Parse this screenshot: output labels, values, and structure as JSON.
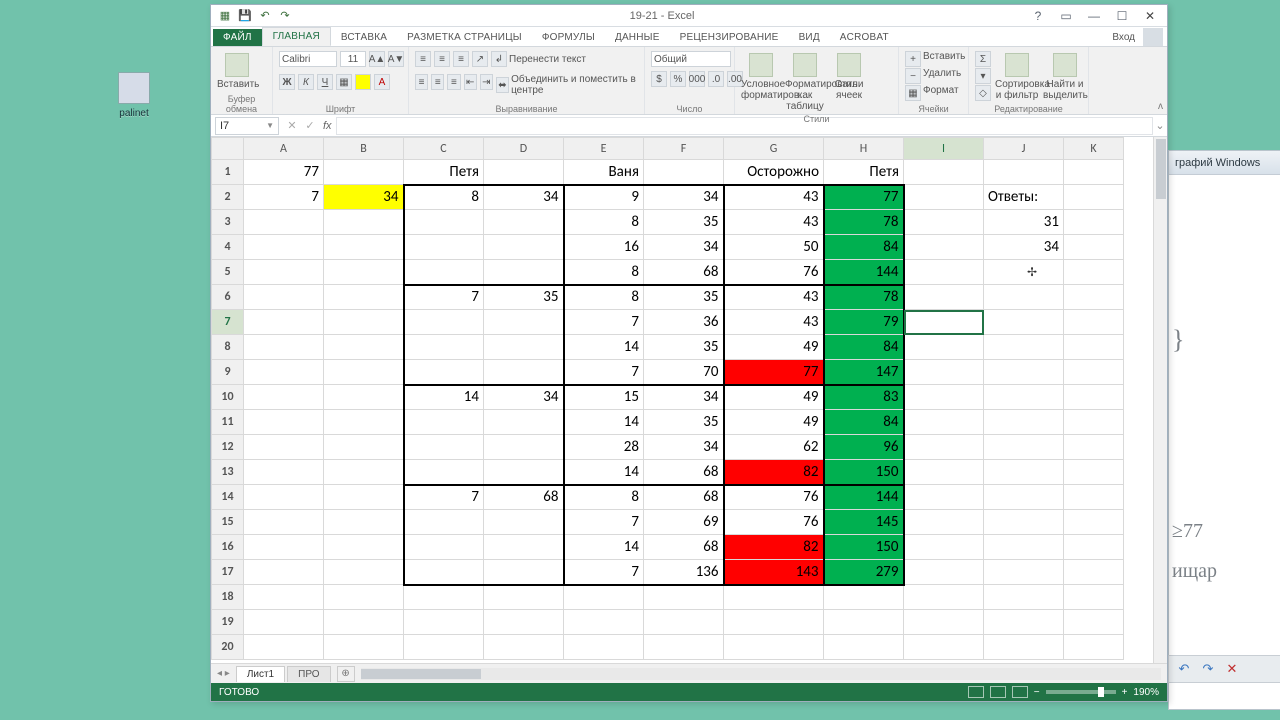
{
  "desktop_icon": {
    "label": "palinet"
  },
  "behind_window": {
    "title": "графий Windows"
  },
  "annotations": {
    "a1": "≥77",
    "a2": "ищар",
    "a3": "}"
  },
  "behind_toolbar": {
    "undo": "↶",
    "redo": "↷",
    "close": "✕"
  },
  "app": {
    "title": "19-21 - Excel",
    "qat": {
      "save": "💾",
      "undo": "↶",
      "redo": "↷"
    },
    "win": {
      "help": "?",
      "ribbon": "▭",
      "min": "—",
      "max": "☐",
      "close": "✕"
    },
    "tabs": {
      "file": "ФАЙЛ",
      "home": "ГЛАВНАЯ",
      "insert": "ВСТАВКА",
      "layout": "РАЗМЕТКА СТРАНИЦЫ",
      "formulas": "ФОРМУЛЫ",
      "data": "ДАННЫЕ",
      "review": "РЕЦЕНЗИРОВАНИЕ",
      "view": "ВИД",
      "acrobat": "ACROBAT",
      "signin": "Вход"
    },
    "ribbon": {
      "clipboard": {
        "paste": "Вставить",
        "caption": "Буфер обмена"
      },
      "font": {
        "name": "Calibri",
        "size": "11",
        "caption": "Шрифт"
      },
      "align": {
        "wrap": "Перенести текст",
        "merge": "Объединить и поместить в центре",
        "caption": "Выравнивание"
      },
      "number": {
        "format": "Общий",
        "caption": "Число"
      },
      "styles": {
        "cond": "Условное форматиров…",
        "table": "Форматировать как таблицу",
        "cell": "Стили ячеек",
        "caption": "Стили"
      },
      "cells": {
        "insert": "Вставить",
        "delete": "Удалить",
        "format": "Формат",
        "caption": "Ячейки"
      },
      "editing": {
        "sort": "Сортировка и фильтр",
        "find": "Найти и выделить",
        "caption": "Редактирование"
      }
    },
    "namebox": "I7",
    "columns": [
      "A",
      "B",
      "C",
      "D",
      "E",
      "F",
      "G",
      "H",
      "I",
      "J",
      "K"
    ],
    "rows": 20,
    "selected": {
      "row": 7,
      "col": "I"
    },
    "cells": {
      "A1": "77",
      "C1": "Петя",
      "E1": "Ваня",
      "G1": "Осторожно",
      "H1": "Петя",
      "J2": "Ответы:",
      "A2": "7",
      "B2": "34",
      "C2": "8",
      "D2": "34",
      "E2": "9",
      "F2": "34",
      "G2": "43",
      "H2": "77",
      "J3": "31",
      "D3": "",
      "E3": "8",
      "F3": "35",
      "G3": "43",
      "H3": "78",
      "J4": "34",
      "E4": "16",
      "F4": "34",
      "G4": "50",
      "H4": "84",
      "E5": "8",
      "F5": "68",
      "G5": "76",
      "H5": "144",
      "C6": "7",
      "D6": "35",
      "E6": "8",
      "F6": "35",
      "G6": "43",
      "H6": "78",
      "E7": "7",
      "F7": "36",
      "G7": "43",
      "H7": "79",
      "E8": "14",
      "F8": "35",
      "G8": "49",
      "H8": "84",
      "E9": "7",
      "F9": "70",
      "G9": "77",
      "H9": "147",
      "C10": "14",
      "D10": "34",
      "E10": "15",
      "F10": "34",
      "G10": "49",
      "H10": "83",
      "E11": "14",
      "F11": "35",
      "G11": "49",
      "H11": "84",
      "E12": "28",
      "F12": "34",
      "G12": "62",
      "H12": "96",
      "E13": "14",
      "F13": "68",
      "G13": "82",
      "H13": "150",
      "C14": "7",
      "D14": "68",
      "E14": "8",
      "F14": "68",
      "G14": "76",
      "H14": "144",
      "E15": "7",
      "F15": "69",
      "G15": "76",
      "H15": "145",
      "E16": "14",
      "F16": "68",
      "G16": "82",
      "H16": "150",
      "E17": "7",
      "F17": "136",
      "G17": "143",
      "H17": "279"
    },
    "fills": {
      "B2": "yellow",
      "H2": "green",
      "H3": "green",
      "H4": "green",
      "H5": "green",
      "H6": "green",
      "H7": "green",
      "H8": "green",
      "H9": "green",
      "H10": "green",
      "H11": "green",
      "H12": "green",
      "H13": "green",
      "H14": "green",
      "H15": "green",
      "H16": "green",
      "H17": "green",
      "G9": "red",
      "G13": "red",
      "G16": "red",
      "G17": "red"
    },
    "sheet_tabs": {
      "active": "Лист1",
      "other": "ПРО"
    },
    "status": {
      "ready": "ГОТОВО",
      "zoom": "190%"
    }
  }
}
